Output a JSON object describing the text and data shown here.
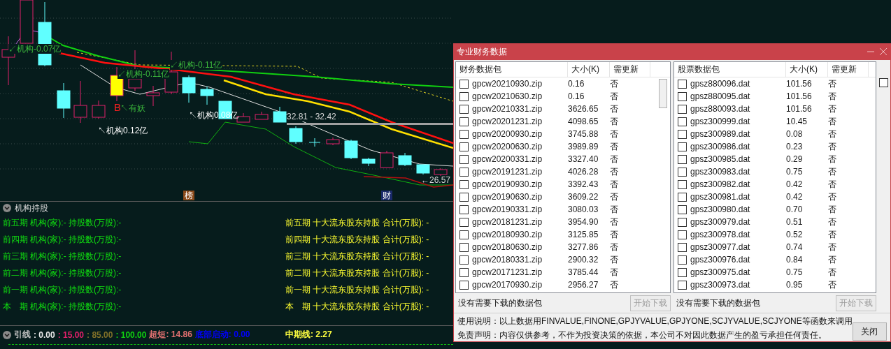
{
  "chart": {
    "annotations": [
      {
        "text": "↙机构-0.07亿",
        "color": "#3cb83c"
      },
      {
        "text": "↙机构-0.11亿",
        "color": "#3cb83c"
      },
      {
        "text": "↙机构-0.11亿",
        "color": "#3cb83c"
      },
      {
        "text": "B",
        "color": "#ff2020"
      },
      {
        "text": "↖有妖",
        "color": "#3cb83c"
      },
      {
        "text": "↖机构0.12亿",
        "color": "#ffffff"
      },
      {
        "text": "↖机构0.08亿",
        "color": "#ffffff"
      },
      {
        "text": "32.81 - 32.42",
        "color": "#d8d8d8"
      },
      {
        "text": "←26.57",
        "color": "#d8d8d8"
      }
    ],
    "badges": [
      {
        "text": "榜",
        "color": "#8a4a1a"
      },
      {
        "text": "财",
        "color": "#1a2a6a"
      }
    ]
  },
  "holdings_panel": {
    "title": "机构持股",
    "rows": [
      {
        "left": "前五期 机构(家):- 持股数(万股):-",
        "right": "前五期 十大流东股东持股 合计(万股): -"
      },
      {
        "left": "前四期 机构(家):- 持股数(万股):-",
        "right": "前四期 十大流东股东持股 合计(万股): -"
      },
      {
        "left": "前三期 机构(家):- 持股数(万股):-",
        "right": "前三期 十大流东股东持股 合计(万股): -"
      },
      {
        "left": "前二期 机构(家):- 持股数(万股):-",
        "right": "前二期 十大流东股东持股 合计(万股): -"
      },
      {
        "left": "前一期 机构(家):- 持股数(万股):-",
        "right": "前一期 十大流东股东持股 合计(万股): -"
      },
      {
        "left": "本　期 机构(家):- 持股数(万股):-",
        "right": "本　期 十大流东股东持股 合计(万股): -"
      }
    ]
  },
  "indicator_bar": {
    "title": "引线",
    "values": [
      {
        "text": ": 0.00",
        "color": "#e8e8e8"
      },
      {
        "text": ": 15.00",
        "color": "#e0206a"
      },
      {
        "text": ": 85.00",
        "color": "#807028"
      },
      {
        "text": ": 100.00",
        "color": "#10d010"
      },
      {
        "text": "超短: 14.86",
        "color": "#e07070"
      },
      {
        "text": "底部启动: 0.00",
        "color": "#0000ff"
      }
    ],
    "aside": {
      "text": "中期线: 2.27",
      "color": "#ffff40"
    }
  },
  "dialog": {
    "title": "专业财务数据",
    "panes": [
      {
        "columns": [
          "财务数据包",
          "大小(K)",
          "需更新"
        ],
        "scrollbar": true,
        "rows": [
          {
            "name": "gpcw20210930.zip",
            "size": "0.16",
            "update": "否",
            "checked": false
          },
          {
            "name": "gpcw20210630.zip",
            "size": "0.16",
            "update": "否",
            "checked": false
          },
          {
            "name": "gpcw20210331.zip",
            "size": "3626.65",
            "update": "否",
            "checked": false
          },
          {
            "name": "gpcw20201231.zip",
            "size": "4098.65",
            "update": "否",
            "checked": false
          },
          {
            "name": "gpcw20200930.zip",
            "size": "3745.88",
            "update": "否",
            "checked": false
          },
          {
            "name": "gpcw20200630.zip",
            "size": "3989.89",
            "update": "否",
            "checked": false
          },
          {
            "name": "gpcw20200331.zip",
            "size": "3327.40",
            "update": "否",
            "checked": false
          },
          {
            "name": "gpcw20191231.zip",
            "size": "4026.28",
            "update": "否",
            "checked": false
          },
          {
            "name": "gpcw20190930.zip",
            "size": "3392.43",
            "update": "否",
            "checked": false
          },
          {
            "name": "gpcw20190630.zip",
            "size": "3609.22",
            "update": "否",
            "checked": false
          },
          {
            "name": "gpcw20190331.zip",
            "size": "3080.03",
            "update": "否",
            "checked": false
          },
          {
            "name": "gpcw20181231.zip",
            "size": "3954.90",
            "update": "否",
            "checked": false
          },
          {
            "name": "gpcw20180930.zip",
            "size": "3125.85",
            "update": "否",
            "checked": false
          },
          {
            "name": "gpcw20180630.zip",
            "size": "3277.86",
            "update": "否",
            "checked": false
          },
          {
            "name": "gpcw20180331.zip",
            "size": "2900.32",
            "update": "否",
            "checked": false
          },
          {
            "name": "gpcw20171231.zip",
            "size": "3785.44",
            "update": "否",
            "checked": false
          },
          {
            "name": "gpcw20170930.zip",
            "size": "2956.27",
            "update": "否",
            "checked": false
          }
        ],
        "status": "没有需要下载的数据包",
        "button": {
          "label": "开始下载",
          "disabled": true
        }
      },
      {
        "columns": [
          "股票数据包",
          "大小(K)",
          "需更新"
        ],
        "scrollbar": false,
        "rows": [
          {
            "name": "gpsz880096.dat",
            "size": "101.56",
            "update": "否",
            "checked": false
          },
          {
            "name": "gpsz880095.dat",
            "size": "101.56",
            "update": "否",
            "checked": false
          },
          {
            "name": "gpsz880093.dat",
            "size": "101.56",
            "update": "否",
            "checked": false
          },
          {
            "name": "gpsz300999.dat",
            "size": "10.45",
            "update": "否",
            "checked": false
          },
          {
            "name": "gpsz300989.dat",
            "size": "0.08",
            "update": "否",
            "checked": false
          },
          {
            "name": "gpsz300986.dat",
            "size": "0.23",
            "update": "否",
            "checked": false
          },
          {
            "name": "gpsz300985.dat",
            "size": "0.29",
            "update": "否",
            "checked": false
          },
          {
            "name": "gpsz300983.dat",
            "size": "0.75",
            "update": "否",
            "checked": false
          },
          {
            "name": "gpsz300982.dat",
            "size": "0.42",
            "update": "否",
            "checked": false
          },
          {
            "name": "gpsz300981.dat",
            "size": "0.42",
            "update": "否",
            "checked": false
          },
          {
            "name": "gpsz300980.dat",
            "size": "0.70",
            "update": "否",
            "checked": false
          },
          {
            "name": "gpsz300979.dat",
            "size": "0.51",
            "update": "否",
            "checked": false
          },
          {
            "name": "gpsz300978.dat",
            "size": "0.52",
            "update": "否",
            "checked": false
          },
          {
            "name": "gpsz300977.dat",
            "size": "0.74",
            "update": "否",
            "checked": false
          },
          {
            "name": "gpsz300976.dat",
            "size": "0.84",
            "update": "否",
            "checked": false
          },
          {
            "name": "gpsz300975.dat",
            "size": "0.75",
            "update": "否",
            "checked": false
          },
          {
            "name": "gpsz300973.dat",
            "size": "0.95",
            "update": "否",
            "checked": false
          }
        ],
        "status": "没有需要下载的数据包",
        "button": {
          "label": "开始下载",
          "disabled": true
        }
      }
    ],
    "option_checkbox": {
      "checked": false
    },
    "notes": [
      "使用说明：以上数据用FINVALUE,FINONE,GPJYVALUE,GPJYONE,SCJYVALUE,SCJYONE等函数来调用",
      "免责声明：内容仅供参考，不作为投资决策的依据，本公司不对因此数据产生的盈亏承担任何责任。"
    ],
    "close_button": "关闭"
  }
}
